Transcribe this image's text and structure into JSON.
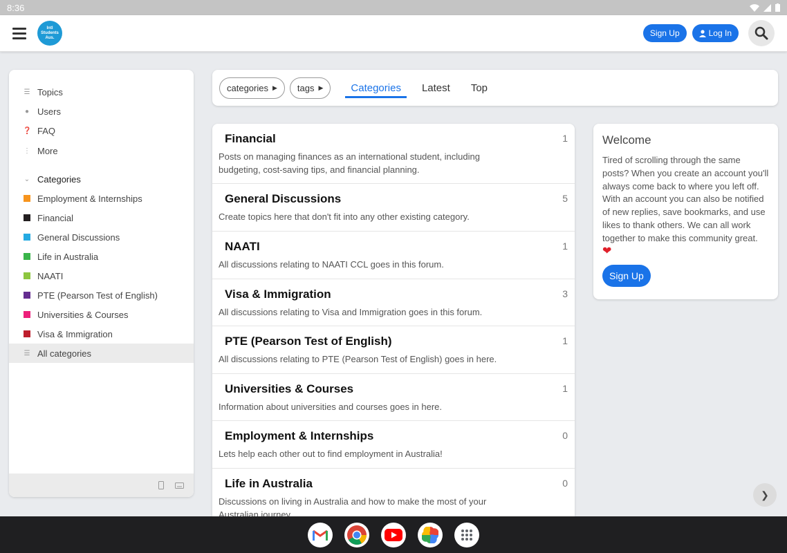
{
  "statusbar": {
    "time": "8:36"
  },
  "header": {
    "logo_text": "Intl Students Aus.",
    "signup_label": "Sign Up",
    "login_label": "Log In"
  },
  "sidebar": {
    "nav": [
      {
        "label": "Topics",
        "icon": "layers-icon"
      },
      {
        "label": "Users",
        "icon": "users-icon"
      },
      {
        "label": "FAQ",
        "icon": "question-icon"
      },
      {
        "label": "More",
        "icon": "more-vertical-icon"
      }
    ],
    "categories_heading": "Categories",
    "categories": [
      {
        "label": "Employment & Internships",
        "color": "#f7941d"
      },
      {
        "label": "Financial",
        "color": "#231f20"
      },
      {
        "label": "General Discussions",
        "color": "#25aae2"
      },
      {
        "label": "Life in Australia",
        "color": "#3ab54a"
      },
      {
        "label": "NAATI",
        "color": "#8dc63f"
      },
      {
        "label": "PTE (Pearson Test of English)",
        "color": "#652d90"
      },
      {
        "label": "Universities & Courses",
        "color": "#ed207b"
      },
      {
        "label": "Visa & Immigration",
        "color": "#be1e2d"
      }
    ],
    "all_categories": "All categories"
  },
  "navbar": {
    "dropdowns": [
      "categories",
      "tags"
    ],
    "tabs": [
      "Categories",
      "Latest",
      "Top"
    ],
    "active_tab": "Categories"
  },
  "category_list": [
    {
      "name": "Financial",
      "count": "1",
      "desc": "Posts on managing finances as an international student, including budgeting, cost-saving tips, and financial planning."
    },
    {
      "name": "General Discussions",
      "count": "5",
      "desc": "Create topics here that don't fit into any other existing category."
    },
    {
      "name": "NAATI",
      "count": "1",
      "desc": "All discussions relating to NAATI CCL goes in this forum."
    },
    {
      "name": "Visa & Immigration",
      "count": "3",
      "desc": "All discussions relating to Visa and Immigration goes in this forum."
    },
    {
      "name": "PTE (Pearson Test of English)",
      "count": "1",
      "desc": "All discussions relating to PTE (Pearson Test of English) goes in here."
    },
    {
      "name": "Universities & Courses",
      "count": "1",
      "desc": "Information about universities and courses goes in here."
    },
    {
      "name": "Employment & Internships",
      "count": "0",
      "desc": "Lets help each other out to find employment in Australia!"
    },
    {
      "name": "Life in Australia",
      "count": "0",
      "desc": "Discussions on living in Australia and how to make the most of your Australian journey."
    }
  ],
  "welcome": {
    "title": "Welcome",
    "body": "Tired of scrolling through the same posts? When you create an account you'll always come back to where you left off. With an account you can also be notified of new replies, save bookmarks, and use likes to thank others. We can all work together to make this community great.",
    "signup_label": "Sign Up"
  },
  "dock": {
    "apps": [
      "gmail-icon",
      "chrome-icon",
      "youtube-icon",
      "photos-icon",
      "app-drawer-icon"
    ]
  }
}
